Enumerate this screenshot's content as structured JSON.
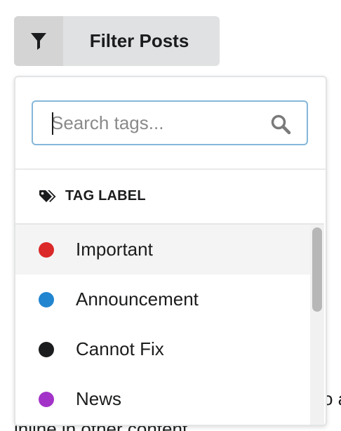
{
  "filter_button": {
    "label": "Filter Posts",
    "icon": "filter-icon"
  },
  "dropdown": {
    "search": {
      "placeholder": "Search tags...",
      "value": "",
      "icon": "search-icon"
    },
    "header": {
      "label": "TAG LABEL",
      "icon": "tags-icon"
    },
    "items": [
      {
        "label": "Important",
        "color": "#db2828"
      },
      {
        "label": "Announcement",
        "color": "#2185d0"
      },
      {
        "label": "Cannot Fix",
        "color": "#1b1c1d"
      },
      {
        "label": "News",
        "color": "#a333c8"
      }
    ]
  },
  "background_text": {
    "line1": "o a",
    "line2": "inline in other content"
  }
}
